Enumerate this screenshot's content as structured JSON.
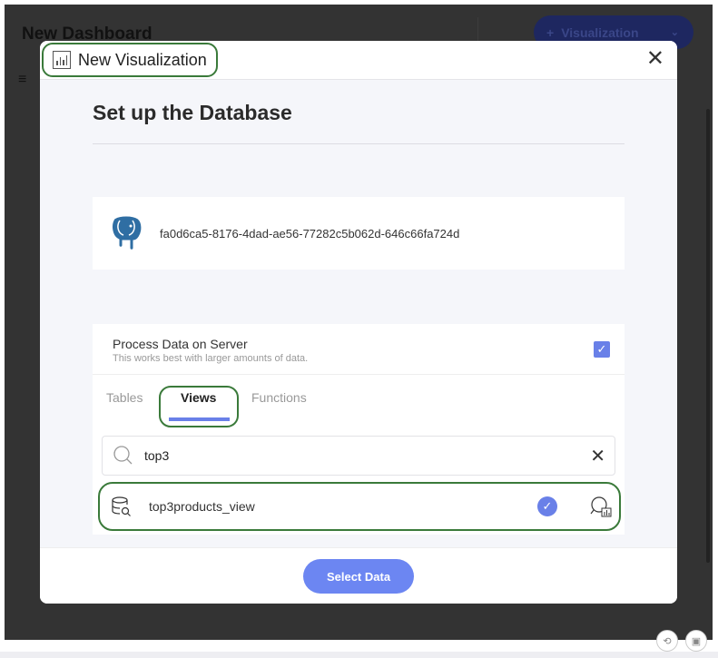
{
  "dashboard": {
    "title": "New Dashboard",
    "add_button": "Visualization"
  },
  "modal": {
    "title": "New Visualization",
    "heading": "Set up the Database"
  },
  "connection": {
    "id": "fa0d6ca5-8176-4dad-ae56-77282c5b062d-646c66fa724d",
    "icon": "postgresql-elephant-icon"
  },
  "process": {
    "title": "Process Data on Server",
    "subtitle": "This works best with larger amounts of data.",
    "checked": true
  },
  "tabs": [
    {
      "label": "Tables",
      "active": false
    },
    {
      "label": "Views",
      "active": true
    },
    {
      "label": "Functions",
      "active": false
    }
  ],
  "search": {
    "value": "top3"
  },
  "results": [
    {
      "name": "top3products_view",
      "selected": true
    }
  ],
  "footer": {
    "select_label": "Select Data"
  },
  "colors": {
    "accent": "#6980e8",
    "highlight": "#3a7a3a",
    "overlay": "#333333"
  }
}
